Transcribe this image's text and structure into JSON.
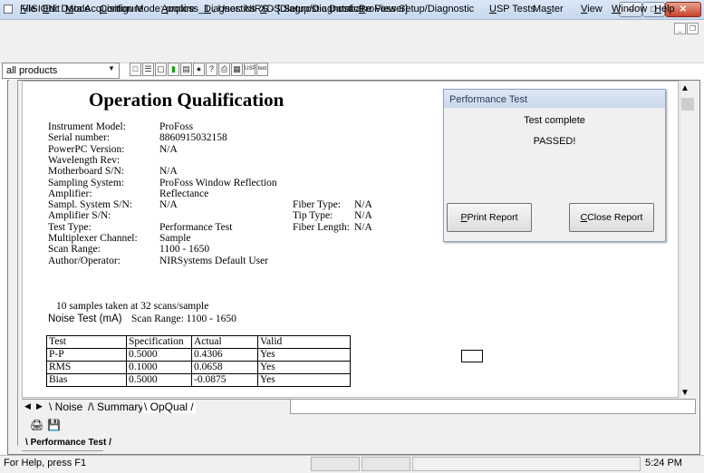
{
  "window": {
    "title": "VISION: Data Acquisition Mode: profoss_1 , User: NIRS - [Diagnostic Database Viewer]",
    "min_glyph": "–",
    "max_glyph": "□",
    "close_glyph": "✕"
  },
  "menu": {
    "items": [
      {
        "u": "F",
        "rest": "ile"
      },
      {
        "u": "E",
        "rest": "dit"
      },
      {
        "u": "M",
        "rest": "ode"
      },
      {
        "pre": "",
        "u": "C",
        "rest": "onfigure"
      },
      {
        "u": "A",
        "rest": "cquire"
      },
      {
        "u": "D",
        "rest": "iagnostics"
      },
      {
        "u": "X",
        "rest": "DS Setup/Diagnostics"
      },
      {
        "u": "P",
        "rest": "roFoss Setup/Diagnostic"
      },
      {
        "u": "U",
        "rest": "SP Tests"
      },
      {
        "pre": "Ma",
        "u": "s",
        "rest": "ter"
      },
      {
        "u": "V",
        "rest": "iew"
      },
      {
        "u": "W",
        "rest": "indow"
      },
      {
        "u": "H",
        "rest": "elp"
      }
    ]
  },
  "toolbar": {
    "product_select": "all products",
    "icons": [
      "new-doc-icon",
      "open-icon",
      "copy-icon",
      "green-icon",
      "save-icon",
      "info-icon",
      "help-pointer-icon",
      "print-icon",
      "preview-icon",
      "usp-icon",
      "text-icon"
    ],
    "usp_label": "USP",
    "text_label": "text"
  },
  "report": {
    "title": "Operation Qualification",
    "fields_left": [
      {
        "label": "Instrument Model:",
        "value": "ProFoss"
      },
      {
        "label": "Serial number:",
        "value": "8860915032158"
      },
      {
        "label": "PowerPC Version:",
        "value": "N/A"
      },
      {
        "label": "Wavelength Rev:",
        "value": ""
      },
      {
        "label": "Motherboard S/N:",
        "value": "N/A"
      },
      {
        "label": "Sampling System:",
        "value": "ProFoss Window Reflection"
      },
      {
        "label": "Amplifier:",
        "value": "Reflectance"
      },
      {
        "label": "Sampl. System S/N:",
        "value": "N/A"
      },
      {
        "label": "Amplifier S/N:",
        "value": ""
      },
      {
        "label": "Test Type:",
        "value": "Performance Test"
      },
      {
        "label": "Multiplexer Channel:",
        "value": "Sample"
      },
      {
        "label": "Scan Range:",
        "value": "1100 - 1650"
      },
      {
        "label": "Author/Operator:",
        "value": "NIRSystems Default User"
      }
    ],
    "fields_right": [
      {
        "label": "Fiber Type:",
        "value": "N/A"
      },
      {
        "label": "Tip Type:",
        "value": "N/A"
      },
      {
        "label": "Fiber Length:",
        "value": "N/A"
      }
    ],
    "samples_line": "10 samples taken at 32 scans/sample",
    "noise_label": "Noise Test (mA)",
    "noise_range": "Scan Range:   1100 - 1650",
    "table": {
      "headers": [
        "Test",
        "Specification",
        "Actual",
        "Valid"
      ],
      "rows": [
        [
          "P-P",
          "0.5000",
          "0.4306",
          "Yes"
        ],
        [
          "RMS",
          "0.1000",
          "0.0658",
          "Yes"
        ],
        [
          "Bias",
          "0.5000",
          "-0.0875",
          "Yes"
        ]
      ]
    }
  },
  "dialog": {
    "title": "Performance Test",
    "line1": "Test complete",
    "line2": "PASSED!",
    "print_button": "Print Report",
    "close_button": "Close Report"
  },
  "sheet_tabs": [
    "Noise",
    "Summary",
    "OpQual"
  ],
  "bottom_tab": "Performance Test",
  "status": {
    "help": "For Help, press F1",
    "time": "5:24 PM"
  }
}
